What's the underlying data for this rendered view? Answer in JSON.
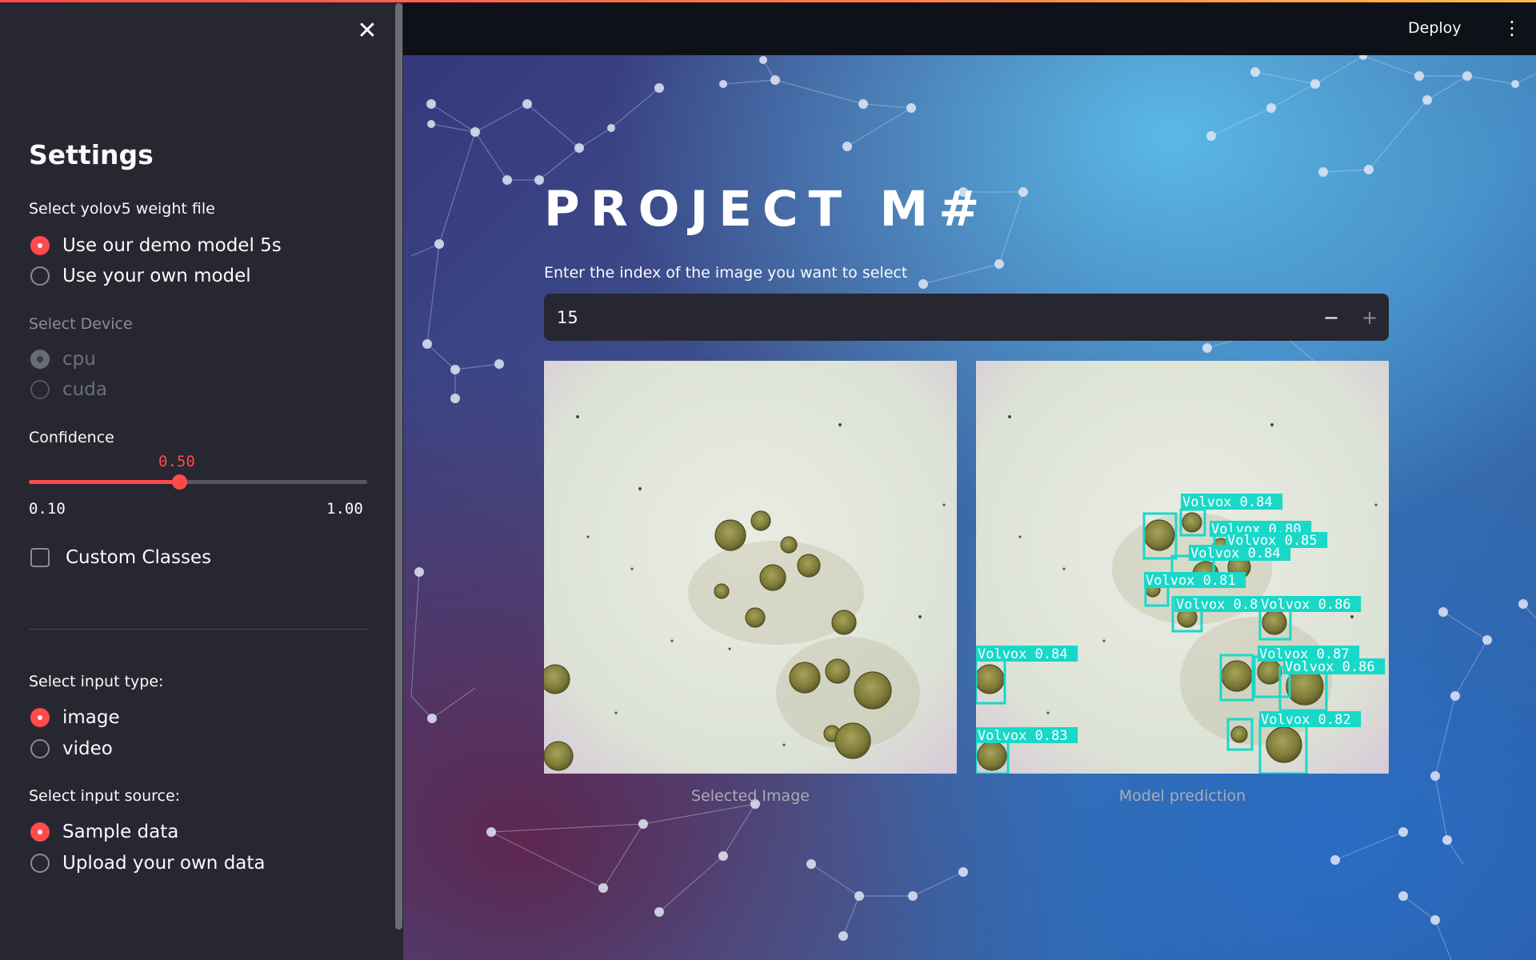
{
  "sidebar": {
    "close_icon": "close-icon",
    "title": "Settings",
    "weight_label": "Select yolov5 weight file",
    "weight_options": [
      "Use our demo model 5s",
      "Use your own model"
    ],
    "weight_selected": "Use our demo model 5s",
    "device_label": "Select Device",
    "device_options": [
      "cpu",
      "cuda"
    ],
    "device_selected": "cpu",
    "confidence_label": "Confidence",
    "confidence_value": "0.50",
    "confidence_min": "0.10",
    "confidence_max": "1.00",
    "confidence_fraction": 0.444,
    "custom_classes_label": "Custom Classes",
    "input_type_label": "Select input type:",
    "input_type_options": [
      "image",
      "video"
    ],
    "input_type_selected": "image",
    "input_source_label": "Select input source:",
    "input_source_options": [
      "Sample data",
      "Upload your own data"
    ],
    "input_source_selected": "Sample data"
  },
  "header": {
    "deploy_label": "Deploy",
    "menu_icon": "kebab-menu-icon"
  },
  "main": {
    "title": "PROJECT M#",
    "index_label": "Enter the index of the image you want to select",
    "index_value": "15",
    "minus_label": "−",
    "plus_label": "+",
    "caption_left": "Selected Image",
    "caption_right": "Model prediction"
  },
  "detections": [
    {
      "label": "Volvox 0.84"
    },
    {
      "label": "Volvox 0.80"
    },
    {
      "label": "Volvox 0.85"
    },
    {
      "label": "Volvox 0.84"
    },
    {
      "label": "Volvox 0.81"
    },
    {
      "label": "Volvox 0.8"
    },
    {
      "label": "Volvox 0.86"
    },
    {
      "label": "Volvox 0.84"
    },
    {
      "label": "Volvox 0.87"
    },
    {
      "label": "Volvox 0.86"
    },
    {
      "label": "Volvox 0.83"
    },
    {
      "label": "Volvox 0.82"
    }
  ],
  "colors": {
    "accent": "#ff4b4b",
    "sidebar_bg": "#262730",
    "topbar_bg": "#0e1117",
    "detection_box": "#19d8c8"
  }
}
